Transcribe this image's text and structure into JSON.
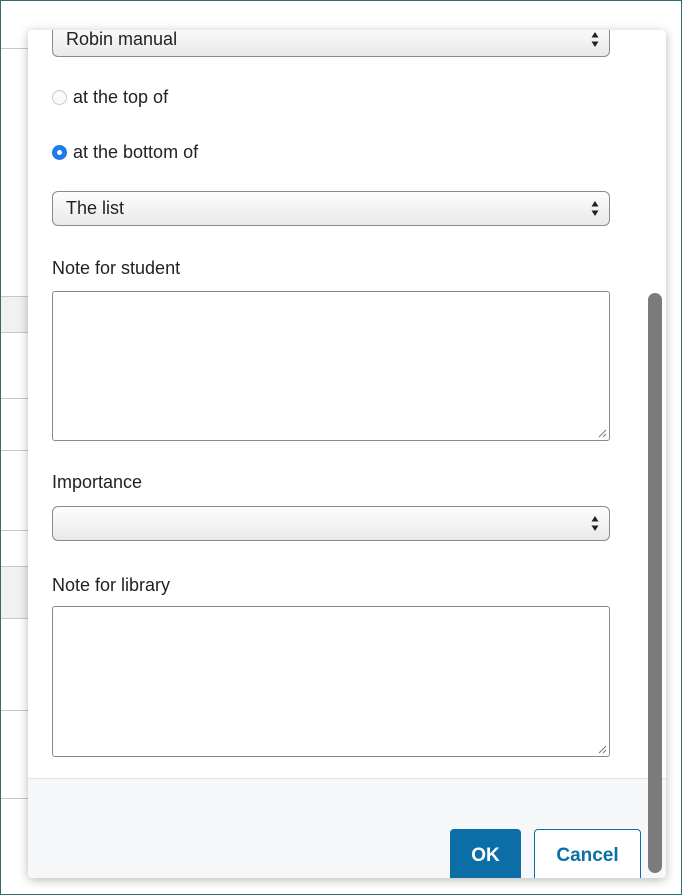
{
  "dialog": {
    "manual_select": {
      "value": "Robin manual"
    },
    "position_options": [
      {
        "label": "at the top of",
        "checked": false
      },
      {
        "label": "at the bottom of",
        "checked": true
      }
    ],
    "list_select": {
      "value": "The list"
    },
    "note_student": {
      "label": "Note for student",
      "value": ""
    },
    "importance": {
      "label": "Importance",
      "value": ""
    },
    "note_library": {
      "label": "Note for library",
      "value": ""
    }
  },
  "footer": {
    "ok_label": "OK",
    "cancel_label": "Cancel"
  },
  "colors": {
    "accent": "#0b6ea7",
    "radio_checked": "#1e7bea"
  }
}
